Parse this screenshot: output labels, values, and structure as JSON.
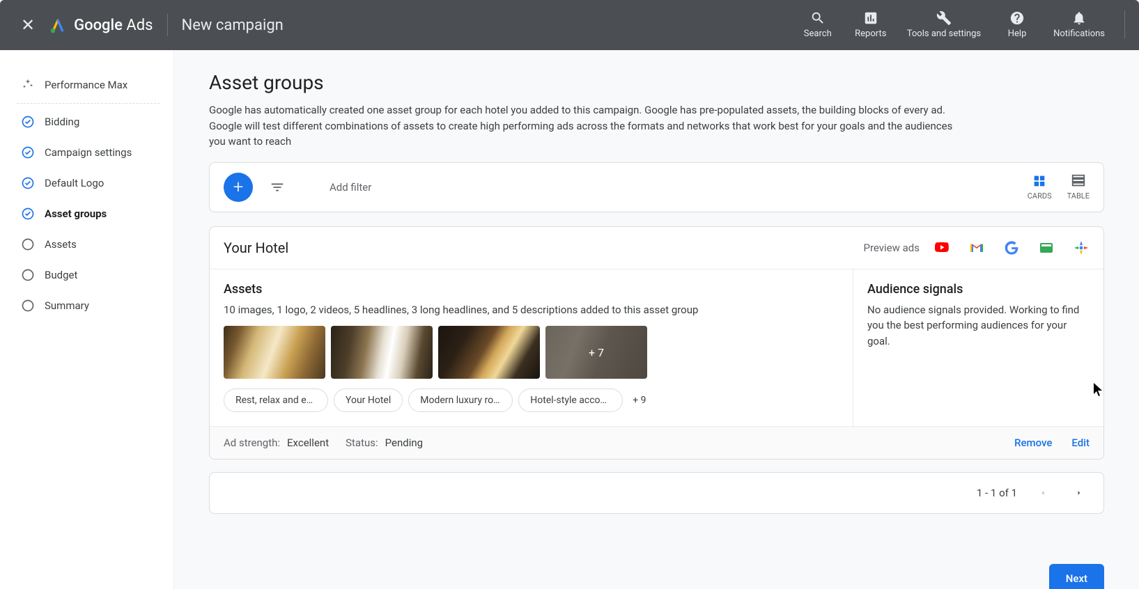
{
  "header": {
    "product": "Google",
    "product_suffix": "Ads",
    "page": "New campaign",
    "actions": [
      {
        "key": "search",
        "label": "Search"
      },
      {
        "key": "reports",
        "label": "Reports"
      },
      {
        "key": "tools",
        "label": "Tools and settings"
      },
      {
        "key": "help",
        "label": "Help"
      },
      {
        "key": "notifications",
        "label": "Notifications"
      }
    ]
  },
  "sidebar": [
    {
      "label": "Performance Max",
      "state": "header"
    },
    {
      "label": "Bidding",
      "state": "done"
    },
    {
      "label": "Campaign settings",
      "state": "done"
    },
    {
      "label": "Default Logo",
      "state": "done"
    },
    {
      "label": "Asset groups",
      "state": "active"
    },
    {
      "label": "Assets",
      "state": "todo"
    },
    {
      "label": "Budget",
      "state": "todo"
    },
    {
      "label": "Summary",
      "state": "todo"
    }
  ],
  "main": {
    "title": "Asset groups",
    "description": "Google has automatically created one asset group for each hotel you added to this campaign. Google has pre-populated assets, the building blocks of every ad. Google will test different combinations of assets to create high performing ads across the formats and networks that work best for your goals and the audiences you want to reach",
    "toolbar": {
      "add_filter": "Add filter",
      "cards": "CARDS",
      "table": "TABLE"
    },
    "group": {
      "name": "Your Hotel",
      "preview": "Preview ads",
      "assets_title": "Assets",
      "assets_desc": "10 images, 1 logo, 2 videos, 5 headlines, 3 long headlines, and 5 descriptions added to this asset group",
      "thumb_more": "+ 7",
      "chips": [
        "Rest, relax and enj...",
        "Your Hotel",
        "Modern luxury roo...",
        "Hotel-style accom..."
      ],
      "chip_more": "+ 9",
      "signals_title": "Audience signals",
      "signals_desc": "No audience signals provided. Working to find you the best performing audiences for your goal.",
      "strength_label": "Ad strength:",
      "strength_value": "Excellent",
      "status_label": "Status:",
      "status_value": "Pending",
      "remove": "Remove",
      "edit": "Edit"
    },
    "pagination": "1 - 1 of 1",
    "next": "Next"
  }
}
